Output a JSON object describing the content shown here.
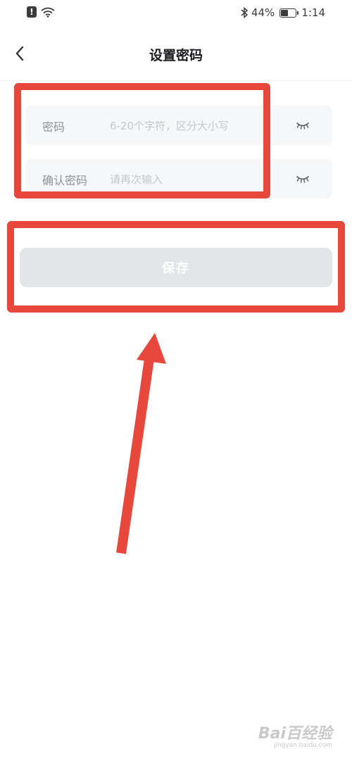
{
  "status_bar": {
    "battery": "44%",
    "time": "1:14"
  },
  "header": {
    "title": "设置密码",
    "back_icon": "chevron-left-icon"
  },
  "form": {
    "password": {
      "label": "密码",
      "placeholder": "6-20个字符，区分大小写",
      "value": "",
      "toggle_icon": "eye-closed-icon"
    },
    "confirm_password": {
      "label": "确认密码",
      "placeholder": "请再次输入",
      "value": "",
      "toggle_icon": "eye-closed-icon"
    },
    "save_label": "保存"
  },
  "watermark": {
    "text": "Bai百经验",
    "url": "jingyan.baidu.com"
  },
  "colors": {
    "annotation": "#e8473b",
    "button_disabled": "#e3e5e8",
    "field_bg": "#f6f7f9"
  }
}
